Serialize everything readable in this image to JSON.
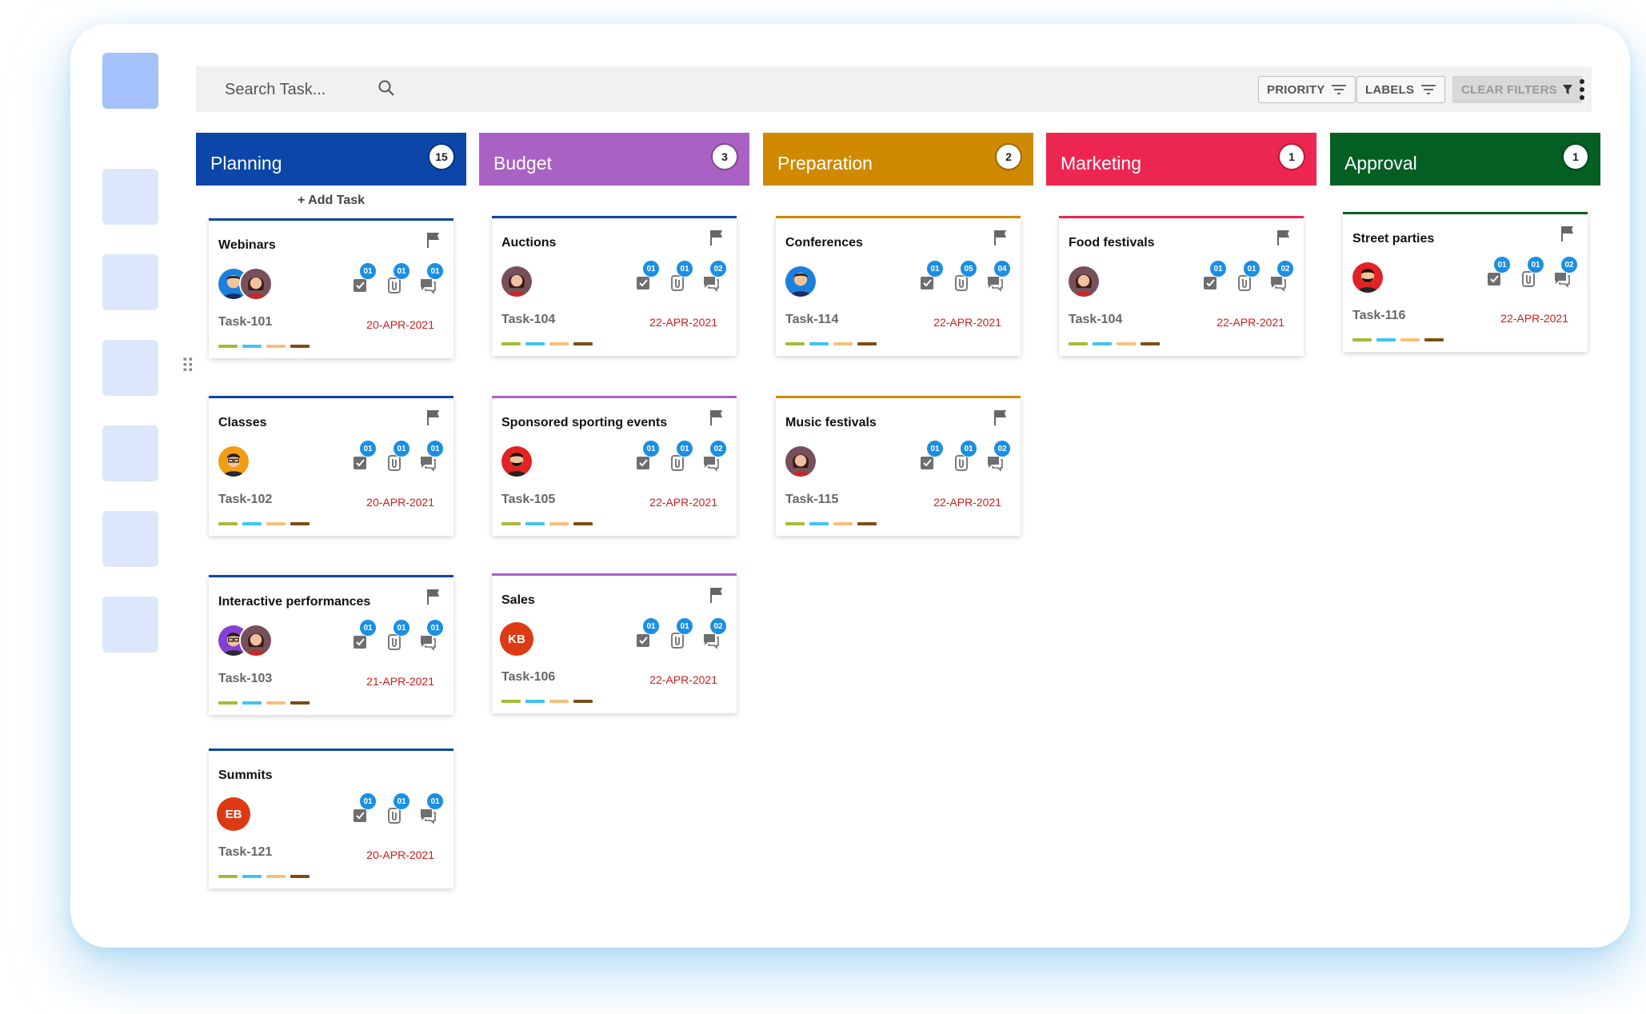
{
  "search": {
    "placeholder": "Search Task..."
  },
  "filters": {
    "priority": "PRIORITY",
    "labels": "LABELS",
    "clear": "CLEAR FILTERS"
  },
  "add_task_label": "+ Add Task",
  "label_colors": [
    "#a8b938",
    "#3fc5ef",
    "#f6c07a",
    "#7d4d12"
  ],
  "columns": [
    {
      "title": "Planning",
      "count": "15",
      "color": "#0b46a8",
      "card_accent": "#0b46a8"
    },
    {
      "title": "Budget",
      "count": "3",
      "color": "#a962c3",
      "card_accent": "#a962c3"
    },
    {
      "title": "Preparation",
      "count": "2",
      "color": "#cf8a02",
      "card_accent": "#cf8a02"
    },
    {
      "title": "Marketing",
      "count": "1",
      "color": "#ec2651",
      "card_accent": "#ec2651"
    },
    {
      "title": "Approval",
      "count": "1",
      "color": "#045f23",
      "card_accent": "#045f23"
    }
  ],
  "cards": [
    {
      "title": "Webinars",
      "task": "Task-101",
      "date": "20-APR-2021",
      "checks": "01",
      "attachments": "01",
      "comments": "01"
    },
    {
      "title": "Classes",
      "task": "Task-102",
      "date": "20-APR-2021",
      "checks": "01",
      "attachments": "01",
      "comments": "01"
    },
    {
      "title": "Interactive performances",
      "task": "Task-103",
      "date": "21-APR-2021",
      "checks": "01",
      "attachments": "01",
      "comments": "01"
    },
    {
      "title": "Summits",
      "task": "Task-121",
      "date": "20-APR-2021",
      "checks": "01",
      "attachments": "01",
      "comments": "01",
      "initials": "EB"
    },
    {
      "title": "Auctions",
      "task": "Task-104",
      "date": "22-APR-2021",
      "checks": "01",
      "attachments": "01",
      "comments": "02"
    },
    {
      "title": "Sponsored sporting events",
      "task": "Task-105",
      "date": "22-APR-2021",
      "checks": "01",
      "attachments": "01",
      "comments": "02"
    },
    {
      "title": "Sales",
      "task": "Task-106",
      "date": "22-APR-2021",
      "checks": "01",
      "attachments": "01",
      "comments": "02",
      "initials": "KB"
    },
    {
      "title": "Conferences",
      "task": "Task-114",
      "date": "22-APR-2021",
      "checks": "01",
      "attachments": "05",
      "comments": "04"
    },
    {
      "title": "Music festivals",
      "task": "Task-115",
      "date": "22-APR-2021",
      "checks": "01",
      "attachments": "01",
      "comments": "02"
    },
    {
      "title": "Food festivals",
      "task": "Task-104",
      "date": "22-APR-2021",
      "checks": "01",
      "attachments": "01",
      "comments": "02"
    },
    {
      "title": "Street parties",
      "task": "Task-116",
      "date": "22-APR-2021",
      "checks": "01",
      "attachments": "01",
      "comments": "02"
    }
  ]
}
